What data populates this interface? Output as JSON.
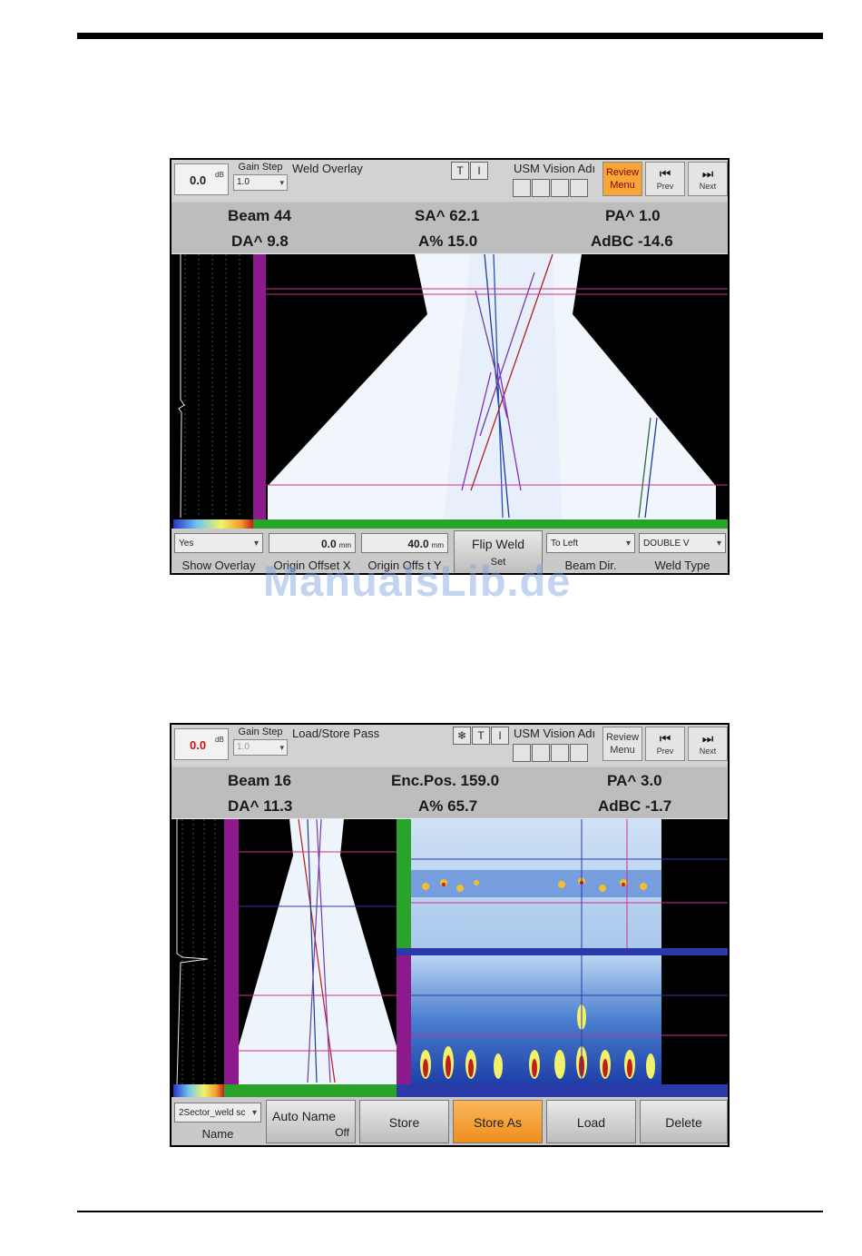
{
  "screens": [
    {
      "gain_value": "0.0",
      "gain_unit": "dB",
      "gain_step_label": "Gain Step",
      "gain_step_value": "1.0",
      "screen_title": "Weld Overlay",
      "product": "USM Vision Adı",
      "review_menu": "Review Menu",
      "prev": "Prev",
      "next": "Next",
      "readouts": {
        "r1c1": "Beam 44",
        "r1c2": "SA^ 62.1",
        "r1c3": "PA^ 1.0",
        "r2c1": "DA^ 9.8",
        "r2c2": "A% 15.0",
        "r2c3": "AdBC -14.6"
      },
      "controls": {
        "show_overlay_value": "Yes",
        "show_overlay_label": "Show Overlay",
        "origin_x_value": "0.0",
        "origin_x_unit": "mm",
        "origin_x_label": "Origin Offset X",
        "origin_y_value": "40.0",
        "origin_y_unit": "mm",
        "origin_y_label": "Origin Offs t Y",
        "flip_weld": "Flip Weld",
        "flip_weld_sub": "Set",
        "beam_dir_value": "To Left",
        "beam_dir_label": "Beam Dir.",
        "weld_type_value": "DOUBLE V",
        "weld_type_label": "Weld Type"
      }
    },
    {
      "gain_value": "0.0",
      "gain_unit": "dB",
      "gain_step_label": "Gain Step",
      "gain_step_value": "1.0",
      "screen_title": "Load/Store Pass",
      "product": "USM Vision Adı",
      "review_menu": "Review Menu",
      "prev": "Prev",
      "next": "Next",
      "readouts": {
        "r1c1": "Beam 16",
        "r1c2": "Enc.Pos. 159.0",
        "r1c3": "PA^ 3.0",
        "r2c1": "DA^ 11.3",
        "r2c2": "A% 65.7",
        "r2c3": "AdBC -1.7"
      },
      "controls": {
        "name_value": "2Sector_weld sc",
        "name_label": "Name",
        "auto_name": "Auto Name",
        "auto_name_state": "Off",
        "store": "Store",
        "store_as": "Store As",
        "load": "Load",
        "delete": "Delete"
      }
    }
  ],
  "watermark": "ManualsLib.de",
  "colors": {
    "accent_orange": "#f5a637",
    "ruler_magenta": "#8c1a8c",
    "ruler_green": "#29a329",
    "plot_bg": "#000000"
  }
}
